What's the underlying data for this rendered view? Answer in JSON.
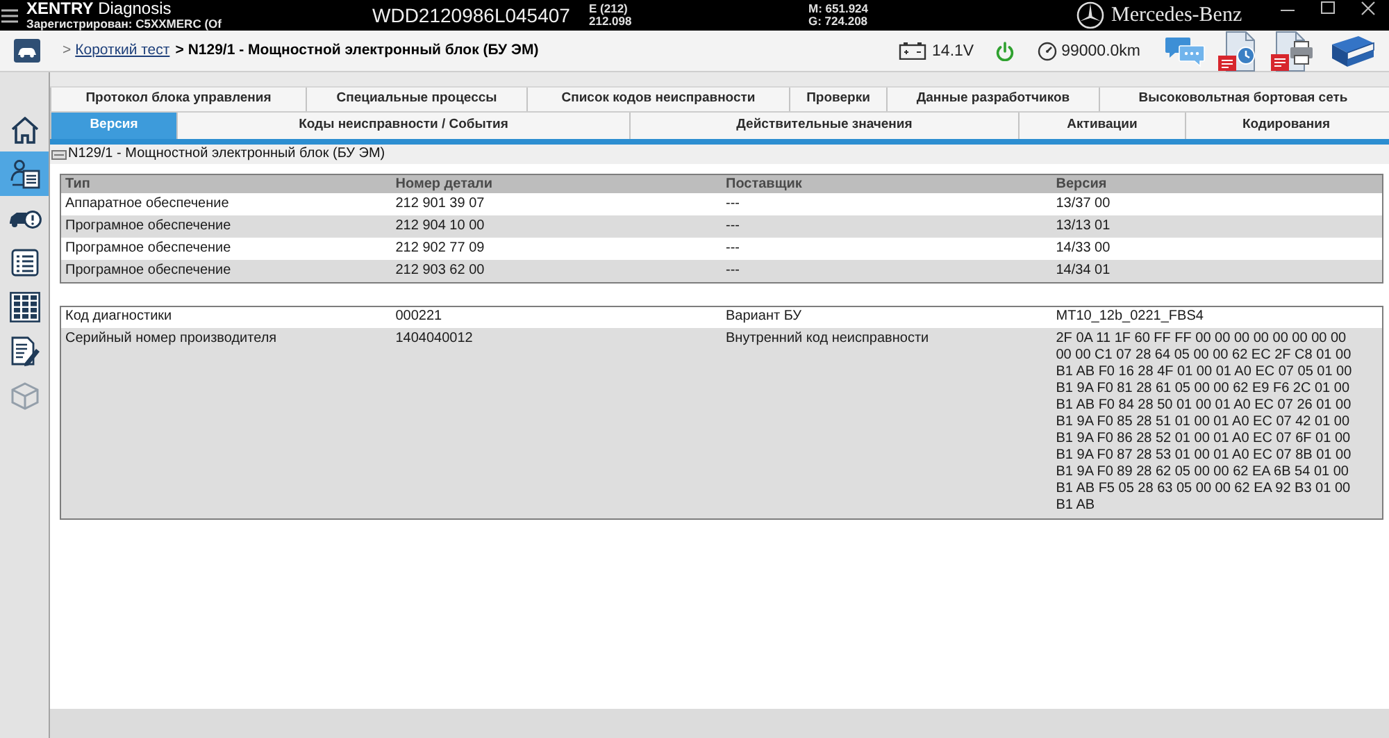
{
  "title_bar": {
    "app_name": "**XENTRY** Diagnosis",
    "registration": "Зарегистрирован: C5XXMERC (Of",
    "vin": "WDD2120986L045407",
    "model": [
      "E (212)",
      "212.098"
    ],
    "engine": [
      "M: 651.924",
      "G: 724.208"
    ],
    "brand": "Mercedes-Benz"
  },
  "toolbar": {
    "breadcrumb": [
      {
        "kind": "link",
        "separator": ">",
        "label": "Короткий тест"
      },
      {
        "kind": "current",
        "separator": ">",
        "label": "N129/1 - Мощностной электронный блок (БУ ЭМ)"
      }
    ],
    "voltage": "14.1V",
    "mileage": "99000.0km"
  },
  "sidebar": {
    "items": [
      {
        "kind": "home",
        "selected": false,
        "disabled": false
      },
      {
        "kind": "person",
        "selected": true,
        "disabled": false
      },
      {
        "kind": "car",
        "selected": false,
        "disabled": false
      },
      {
        "kind": "list",
        "selected": false,
        "disabled": false
      },
      {
        "kind": "grid",
        "selected": false,
        "disabled": false
      },
      {
        "kind": "document",
        "selected": false,
        "disabled": false
      },
      {
        "kind": "box",
        "selected": false,
        "disabled": true
      }
    ]
  },
  "tab_rows": [
    [
      {
        "label": "Протокол блока управления",
        "selected": false
      },
      {
        "label": "Специальные процессы",
        "selected": false
      },
      {
        "label": "Список кодов неисправности",
        "selected": false
      },
      {
        "label": "Проверки",
        "selected": false
      },
      {
        "label": "Данные разработчиков",
        "selected": false
      },
      {
        "label": "Высоковольтная бортовая сеть",
        "selected": false
      }
    ],
    [
      {
        "label": "Версия",
        "selected": true
      },
      {
        "label": "Коды неисправности / События",
        "selected": false
      },
      {
        "label": "Действительные значения",
        "selected": false
      },
      {
        "label": "Активации",
        "selected": false
      },
      {
        "label": "Кодирования",
        "selected": false
      }
    ]
  ],
  "panel": {
    "title": "N129/1 - Мощностной электронный блок (БУ ЭМ)",
    "version_table": {
      "columns": [
        "Тип",
        "Номер детали",
        "Поставщик",
        "Версия"
      ],
      "rows": [
        [
          "Аппаратное обеспечение",
          "212 901 39 07",
          "---",
          "13/37 00"
        ],
        [
          "Програмное обеспечение",
          "212 904 10 00",
          "---",
          "13/13 01"
        ],
        [
          "Програмное обеспечение",
          "212 902 77 09",
          "---",
          "14/33 00"
        ],
        [
          "Програмное обеспечение",
          "212 903 62 00",
          "---",
          "14/34 01"
        ]
      ]
    },
    "info_table": {
      "rows": [
        [
          "Код диагностики",
          "000221",
          "Вариант БУ",
          "MT10_12b_0221_FBS4"
        ],
        [
          "Серийный номер производителя",
          "1404040012",
          "Внутренний код неисправности",
          "2F 0A 11 1F 60 FF FF 00 00 00 00 00 00 00 00\n00 00 C1 07 28 64 05 00 00 62 EC 2F C8 01 00\nB1 AB F0 16 28 4F 01 00 01 A0 EC 07 05 01 00\nB1 9A F0 81 28 61 05 00 00 62 E9 F6 2C 01 00\nB1 AB F0 84 28 50 01 00 01 A0 EC 07 26 01 00\nB1 9A F0 85 28 51 01 00 01 A0 EC 07 42 01 00\nB1 9A F0 86 28 52 01 00 01 A0 EC 07 6F 01 00\nB1 9A F0 87 28 53 01 00 01 A0 EC 07 8B 01 00\nB1 9A F0 89 28 62 05 00 00 62 EA 6B 54 01 00\nB1 AB F5 05 28 63 05 00 00 62 EA 92 B3 01 00\nB1 AB"
        ]
      ]
    }
  }
}
